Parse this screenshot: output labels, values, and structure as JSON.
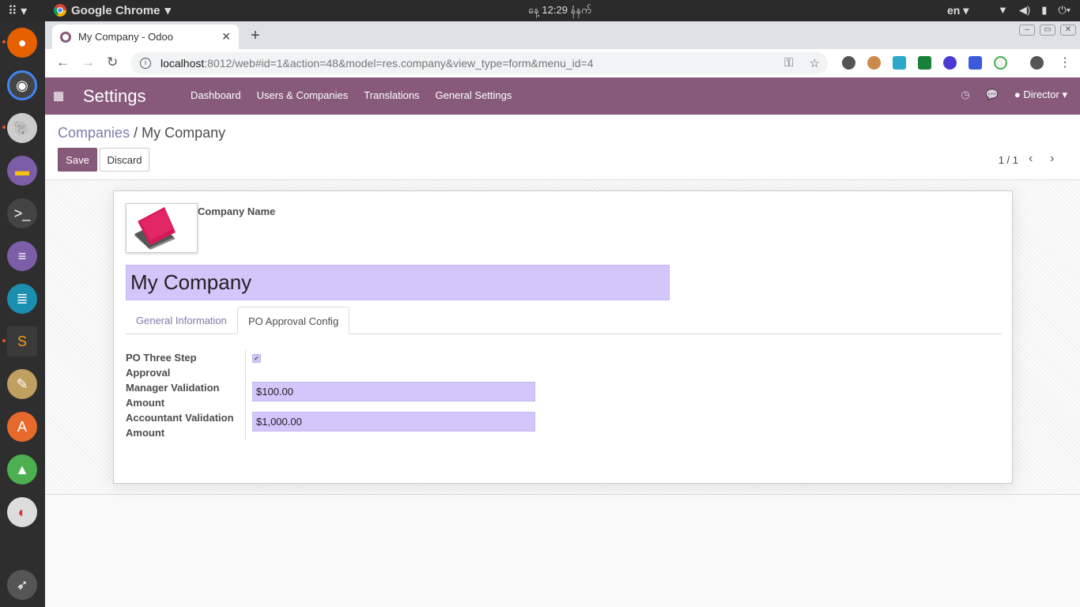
{
  "os": {
    "app_name": "Google Chrome",
    "clock": "နေ့ 12:29 နံနက်",
    "lang": "en"
  },
  "browser": {
    "tab_title": "My Company - Odoo",
    "url_host": "localhost",
    "url_path": ":8012/web#id=1&action=48&model=res.company&view_type=form&menu_id=4"
  },
  "odoo": {
    "app_title": "Settings",
    "menu": [
      "Dashboard",
      "Users & Companies",
      "Translations",
      "General Settings"
    ],
    "user": "Director"
  },
  "control": {
    "breadcrumb_parent": "Companies",
    "breadcrumb_sep": "/",
    "breadcrumb_current": "My Company",
    "save_label": "Save",
    "discard_label": "Discard",
    "pager": "1 / 1"
  },
  "form": {
    "company_name_label": "Company Name",
    "company_name": "My Company",
    "tabs": [
      "General Information",
      "PO Approval Config"
    ],
    "fields": {
      "po_three_step_label": "PO Three Step Approval",
      "po_three_step_checked": true,
      "manager_label": "Manager Validation Amount",
      "manager_value": "$100.00",
      "accountant_label": "Accountant Validation Amount",
      "accountant_value": "$1,000.00"
    }
  },
  "colors": {
    "odoo_purple": "#875a7b",
    "required_field_bg": "#d2c6fb",
    "link": "#7c7bad"
  }
}
